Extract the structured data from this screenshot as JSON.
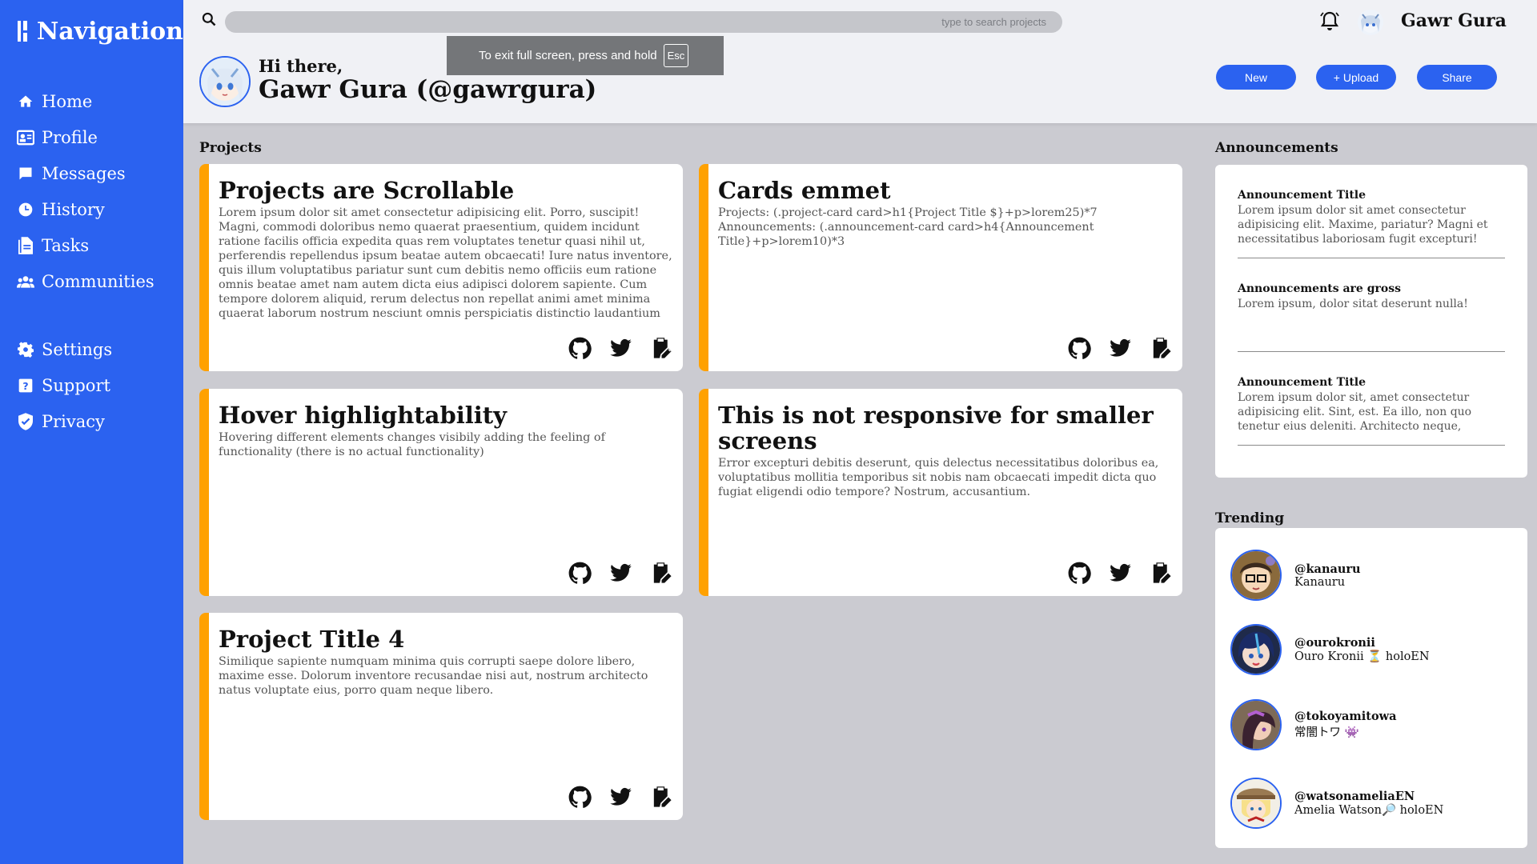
{
  "sidebar": {
    "title": "Navigation",
    "items": [
      {
        "label": "Home",
        "icon": "home-icon"
      },
      {
        "label": "Profile",
        "icon": "profile-card-icon"
      },
      {
        "label": "Messages",
        "icon": "message-icon"
      },
      {
        "label": "History",
        "icon": "clock-icon"
      },
      {
        "label": "Tasks",
        "icon": "document-icon"
      },
      {
        "label": "Communities",
        "icon": "people-icon"
      }
    ],
    "secondary": [
      {
        "label": "Settings",
        "icon": "gear-icon"
      },
      {
        "label": "Support",
        "icon": "help-icon"
      },
      {
        "label": "Privacy",
        "icon": "shield-icon"
      }
    ]
  },
  "header": {
    "search_placeholder": "type to search projects",
    "user_name": "Gawr Gura",
    "greeting": "Hi there,",
    "full_name": "Gawr Gura (@gawrgura)",
    "buttons": {
      "new": "New",
      "upload": "+ Upload",
      "share": "Share"
    },
    "fullscreen_toast": {
      "text": "To exit full screen, press and hold",
      "key": "Esc"
    }
  },
  "projects": {
    "heading": "Projects",
    "cards": [
      {
        "title": "Projects are Scrollable",
        "body": "Lorem ipsum dolor sit amet consectetur adipisicing elit. Porro, suscipit! Magni, commodi doloribus nemo quaerat praesentium, quidem incidunt ratione facilis officia expedita quas rem voluptates tenetur quasi nihil ut, perferendis repellendus ipsum beatae autem obcaecati! Iure natus inventore, quis illum voluptatibus pariatur sunt cum debitis nemo officiis eum ratione omnis beatae amet nam autem dicta eius adipisci dolorem sapiente. Cum tempore dolorem aliquid, rerum delectus non repellat animi amet minima quaerat laborum nostrum nesciunt omnis perspiciatis distinctio laudantium quis aperiam consectetur eos eaque quia atque magni! Aspernatur placeat quo ea officiis,"
      },
      {
        "title": "Cards emmet",
        "body": "Projects: (.project-card card>h1{Project Title $}+p>lorem25)*7\nAnnouncements: (.announcement-card card>h4{Announcement Title}+p>lorem10)*3"
      },
      {
        "title": "Hover highlightability",
        "body": "Hovering different elements changes visibily adding the feeling of functionality (there is no actual functionality)"
      },
      {
        "title": "This is not responsive for smaller screens",
        "body": "Error excepturi debitis deserunt, quis delectus necessitatibus doloribus ea, voluptatibus mollitia temporibus sit nobis nam obcaecati impedit dicta quo fugiat eligendi odio tempore? Nostrum, accusantium."
      },
      {
        "title": "Project Title 4",
        "body": "Similique sapiente numquam minima quis corrupti saepe dolore libero, maxime esse. Dolorum inventore recusandae nisi aut, nostrum architecto natus voluptate eius, porro quam neque libero."
      }
    ]
  },
  "announcements": {
    "heading": "Announcements",
    "items": [
      {
        "title": "Announcement Title",
        "body": "Lorem ipsum dolor sit amet consectetur adipisicing elit. Maxime, pariatur? Magni et necessitatibus laboriosam fugit excepturi!"
      },
      {
        "title": "Announcements are gross",
        "body": "Lorem ipsum, dolor sitat deserunt nulla!"
      },
      {
        "title": "Announcement Title",
        "body": "Lorem ipsum dolor sit, amet consectetur adipisicing elit. Sint, est. Ea illo, non quo tenetur eius deleniti. Architecto neque, similique incidunt"
      }
    ]
  },
  "trending": {
    "heading": "Trending",
    "items": [
      {
        "handle": "@kanauru",
        "display": "Kanauru"
      },
      {
        "handle": "@ourokronii",
        "display": "Ouro Kronii ⏳ holoEN"
      },
      {
        "handle": "@tokoyamitowa",
        "display": "常闇トワ 👾"
      },
      {
        "handle": "@watsonameliaEN",
        "display": "Amelia Watson🔎 holoEN"
      }
    ]
  },
  "colors": {
    "accent": "#2b62f0",
    "card_stripe": "#ffa100",
    "background": "#cbcbd1"
  }
}
